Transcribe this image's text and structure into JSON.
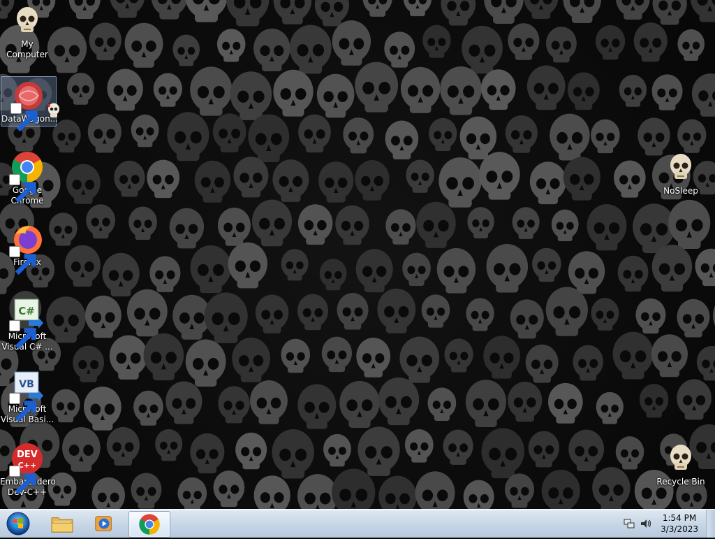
{
  "desktop": {
    "icons": [
      {
        "name": "my-computer",
        "label": "My Computer"
      },
      {
        "name": "datawagon",
        "label": "DataWagon..."
      },
      {
        "name": "google-chrome",
        "label": "Google\nChrome"
      },
      {
        "name": "firefox",
        "label": "Firefox"
      },
      {
        "name": "visual-csharp",
        "label": "Microsoft\nVisual C# ..."
      },
      {
        "name": "visual-basic",
        "label": "Microsoft\nVisual Basi..."
      },
      {
        "name": "dev-cpp",
        "label": "Embarcadero\nDev-C++"
      },
      {
        "name": "nosleep",
        "label": "NoSleep"
      },
      {
        "name": "recycle-bin",
        "label": "Recycle Bin"
      }
    ],
    "dev_icon_text": {
      "top": "DEV",
      "bottom": "C++"
    },
    "cs_icon_text": "C#",
    "vb_icon_text": "VB"
  },
  "taskbar": {
    "clock_time": "1:54 PM",
    "clock_date": "3/3/2023"
  },
  "colors": {
    "chrome_red": "#DB4437",
    "chrome_yellow": "#F4B400",
    "chrome_green": "#0F9D58",
    "chrome_blue": "#4285F4",
    "dev_red": "#D62B2B"
  }
}
